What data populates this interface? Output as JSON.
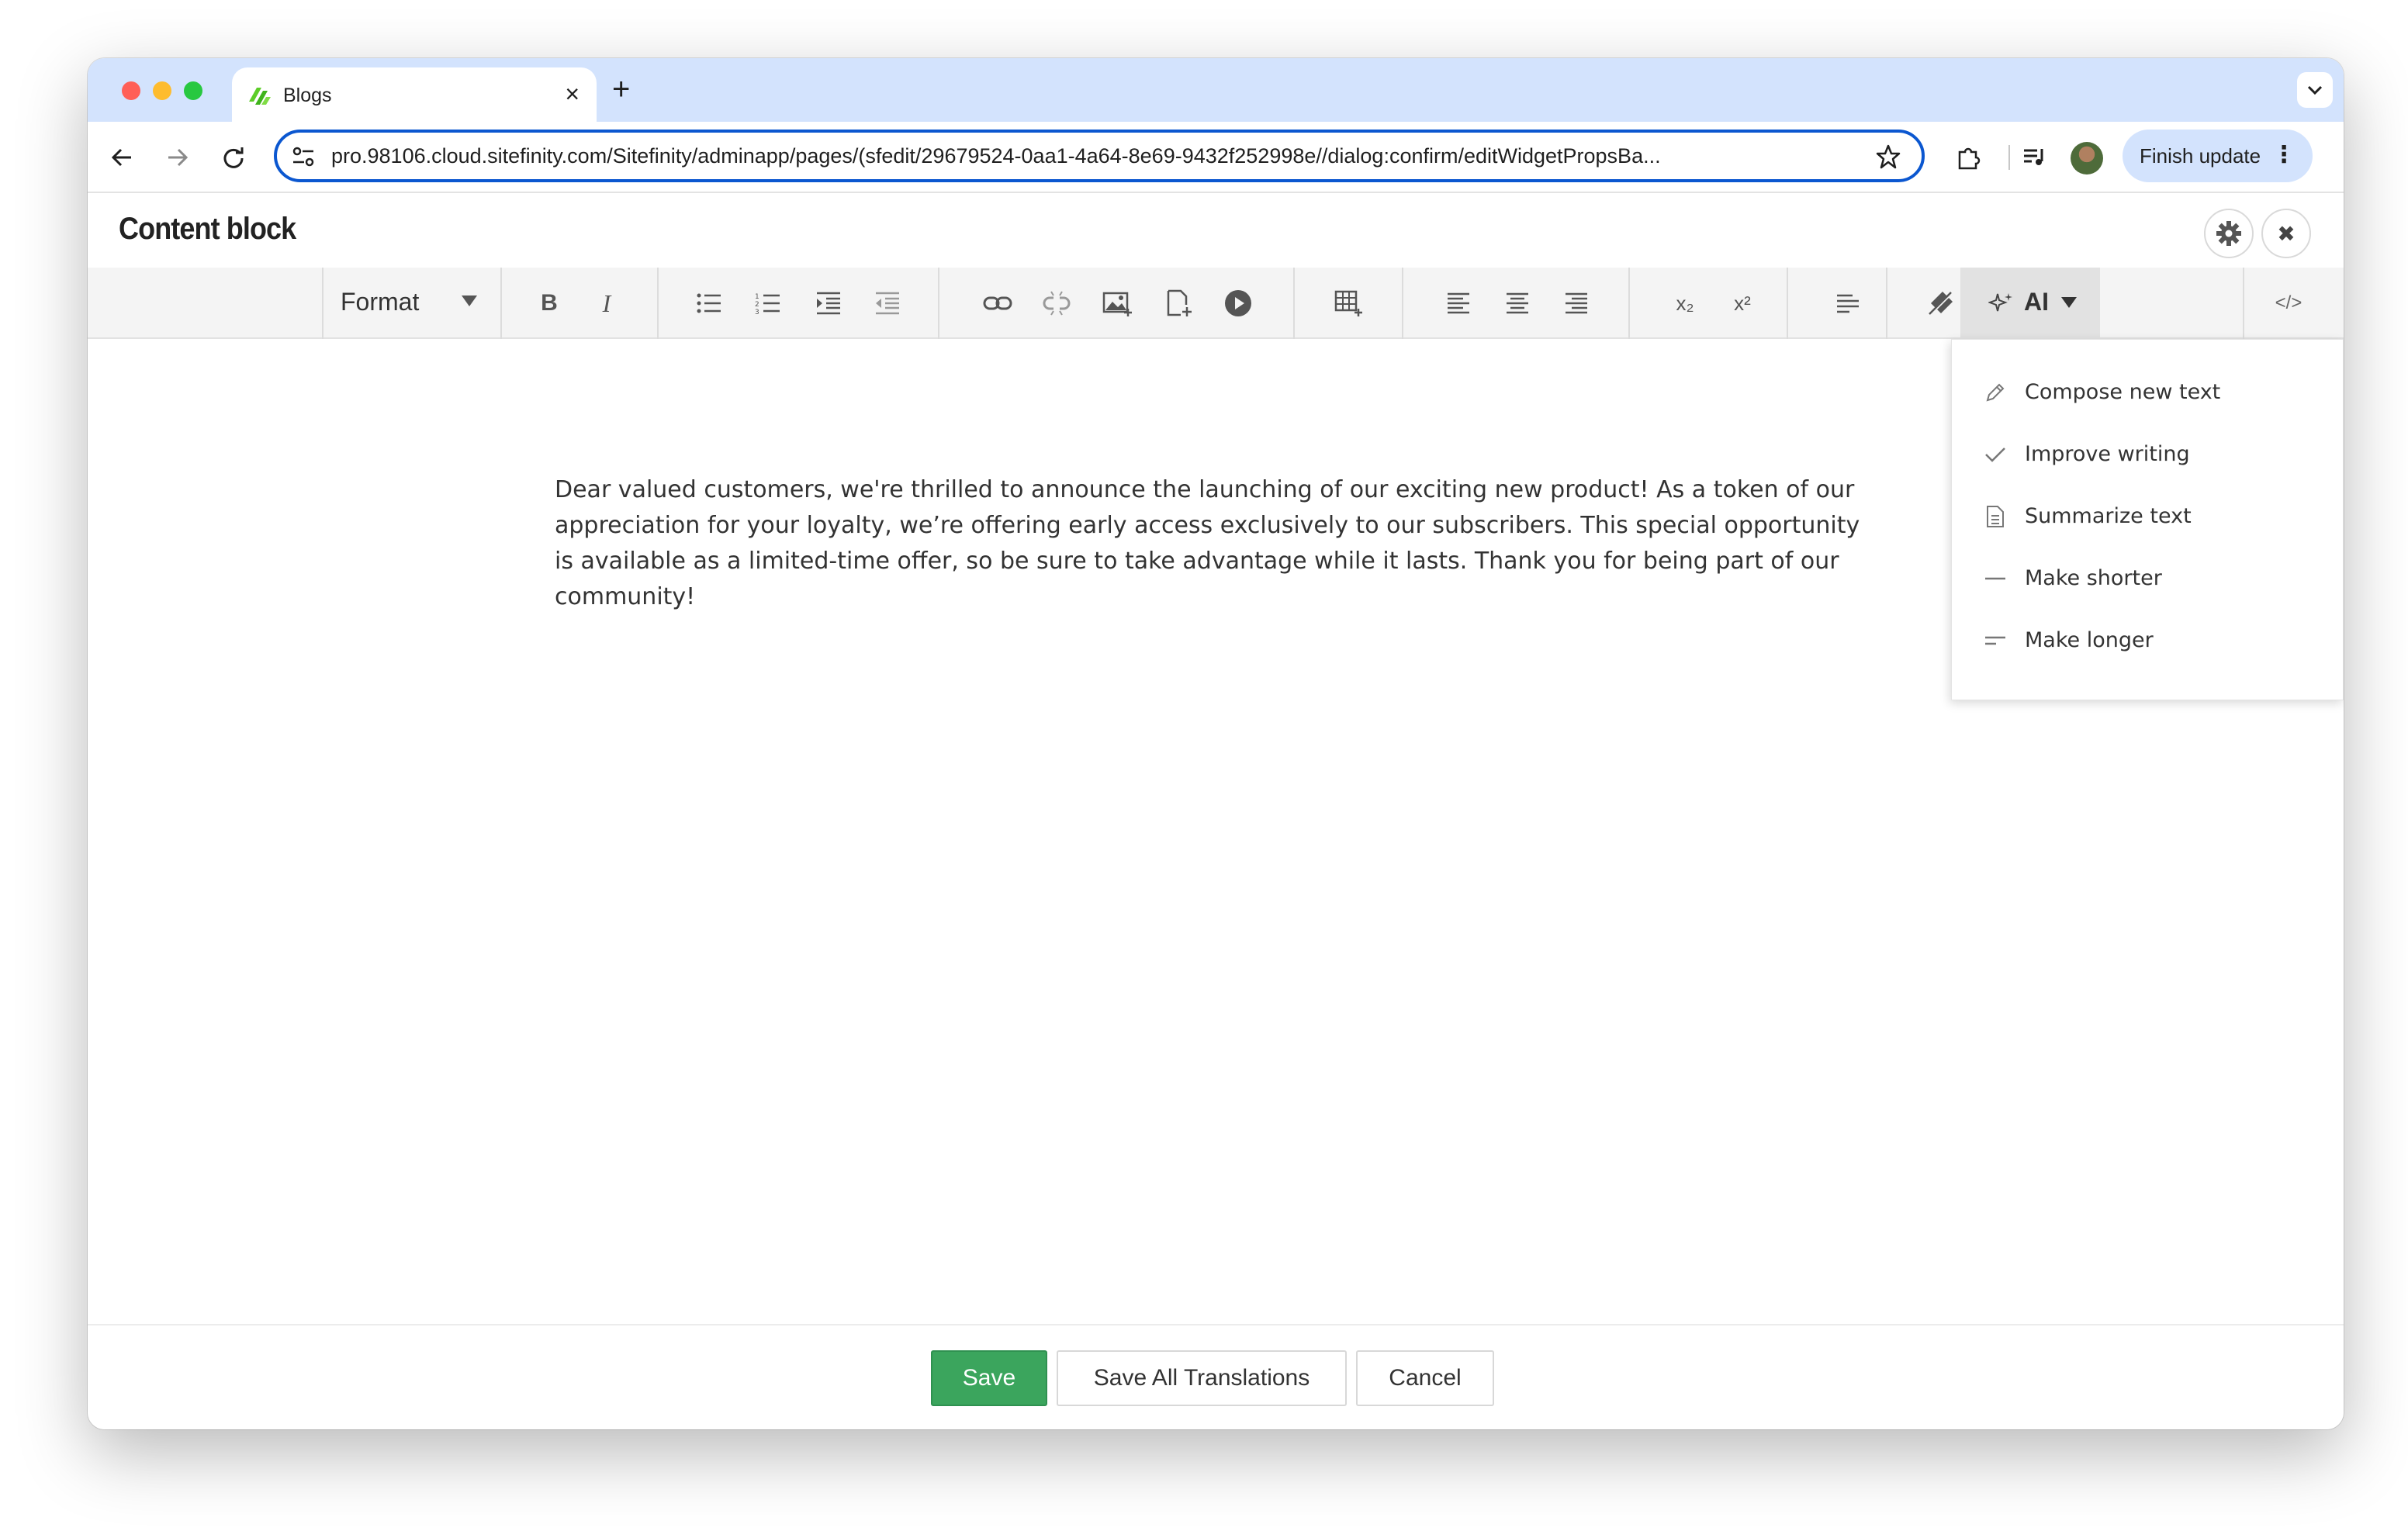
{
  "browser": {
    "tab": {
      "title": "Blogs"
    },
    "new_tab": "+",
    "address": {
      "url": "pro.98106.cloud.sitefinity.com/Sitefinity/adminapp/pages/(sfedit/29679524-0aa1-4a64-8e69-9432f252998e//dialog:confirm/editWidgetPropsBa..."
    },
    "finish_update_label": "Finish update",
    "menu_dots": "⋮"
  },
  "dialog": {
    "title": "Content block",
    "close_glyph": "✖"
  },
  "toolbar": {
    "format_label": "Format",
    "ai_label": "AI",
    "subscript_glyph": "x₂",
    "superscript_glyph": "x²",
    "bold_glyph": "B",
    "italic_glyph": "I",
    "source_glyph": "</>"
  },
  "editor": {
    "content": "Dear valued customers, we're thrilled to announce the launching of our exciting new product! As a token of our appreciation for your loyalty, we’re offering early access exclusively to our subscribers. This special opportunity is available as a limited-time offer, so be sure to take advantage while it lasts. Thank you for being part of our community!"
  },
  "ai_menu": {
    "items": [
      {
        "label": "Compose new text",
        "icon": "pencil-icon"
      },
      {
        "label": "Improve writing",
        "icon": "check-icon"
      },
      {
        "label": "Summarize text",
        "icon": "document-icon"
      },
      {
        "label": "Make shorter",
        "icon": "short-line-icon"
      },
      {
        "label": "Make longer",
        "icon": "long-lines-icon"
      }
    ]
  },
  "footer": {
    "save_label": "Save",
    "save_translations_label": "Save All Translations",
    "cancel_label": "Cancel"
  },
  "colors": {
    "save_green": "#3ba55d",
    "omnibox_blue": "#0b57d0",
    "tabstrip": "#d3e3fd"
  }
}
